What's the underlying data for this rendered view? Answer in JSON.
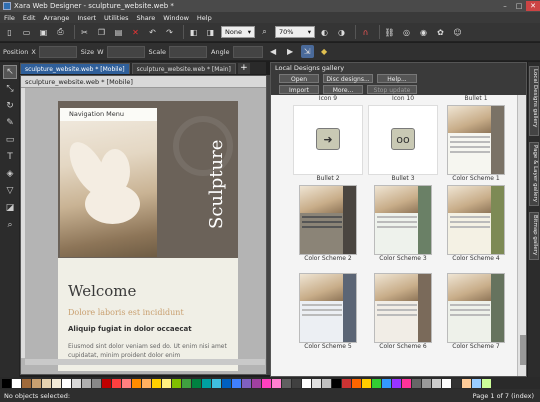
{
  "window": {
    "title": "Xara Web Designer - sculpture_website.web *",
    "minimize": "–",
    "maximize": "□",
    "close": "✕"
  },
  "menu": [
    "File",
    "Edit",
    "Arrange",
    "Insert",
    "Utilities",
    "Share",
    "Window",
    "Help"
  ],
  "toolbar": {
    "quality_select": "None",
    "zoom_select": "70%"
  },
  "infobar": {
    "position_label": "Position",
    "x_label": "X",
    "y_label": "Y",
    "size_label": "Size",
    "w_label": "W",
    "h_label": "H",
    "scale_label": "Scale",
    "angle_label": "Angle"
  },
  "doc_tabs": [
    {
      "label": "sculpture_website.web * [Mobile]",
      "active": true
    },
    {
      "label": "sculpture_website.web * [Main]",
      "active": false
    }
  ],
  "doc_tab_add": "+",
  "doc_window": {
    "title": "sculpture_website.web * [Mobile]",
    "nav_menu": "Navigation Menu",
    "sculpture": "Sculpture",
    "welcome": "Welcome",
    "subheading": "Dolore laboris est incididunt",
    "bold_line": "Aliquip fugiat in dolor occaecat",
    "body_text": "Eiusmod sint dolor veniam sed do. Ut enim nisi amet cupidatat, minim proident dolor enim"
  },
  "gallery": {
    "title": "Local Designs gallery",
    "buttons": [
      {
        "label": "Open",
        "enabled": true
      },
      {
        "label": "Disc designs...",
        "enabled": true
      },
      {
        "label": "Help...",
        "enabled": true
      },
      {
        "label": "Import",
        "enabled": true
      },
      {
        "label": "More...",
        "enabled": true
      },
      {
        "label": "Stop update",
        "enabled": false
      }
    ],
    "top_labels": [
      "Icon 9",
      "Icon 10",
      "Bullet 1"
    ],
    "rows": [
      [
        "Bullet 2",
        "Bullet 3",
        "Color Scheme 1"
      ],
      [
        "Color Scheme 2",
        "Color Scheme 3",
        "Color Scheme 4"
      ],
      [
        "Color Scheme 5",
        "Color Scheme 6",
        "Color Scheme 7"
      ]
    ],
    "bullet2_glyph": "➜",
    "bullet3_glyph": "oo"
  },
  "side_tabs": [
    "Local Designs gallery",
    "Page & Layer gallery",
    "Bitmap gallery"
  ],
  "status": {
    "selection": "No objects selected:",
    "page_indicator": "Page 1 of 7 (index)"
  },
  "palette_colors": [
    "#000000",
    "#ffffff",
    "#a06a3a",
    "#c8a070",
    "#e6d2b0",
    "#f3ead8",
    "#ffffff",
    "#d8d8d8",
    "#b0b0b0",
    "#888888",
    "#c00000",
    "#ff4040",
    "#ff8080",
    "#ff8c00",
    "#ffb060",
    "#ffd000",
    "#fff080",
    "#80c000",
    "#40a040",
    "#008040",
    "#00a0a0",
    "#40c0e0",
    "#0060c0",
    "#4080ff",
    "#8060c0",
    "#a040a0",
    "#ff40c0",
    "#ff80d0",
    "#606060",
    "#404040",
    "#ffffff",
    "#e0e0e0",
    "#c0c0c0",
    "#000000",
    "#cc3333",
    "#ff6600",
    "#ffcc00",
    "#33cc33",
    "#3399ff",
    "#9933ff",
    "#ff3399",
    "#666666",
    "#999999",
    "#cccccc",
    "#ffffff",
    "#333333",
    "#ffcc99",
    "#99ccff",
    "#ccff99"
  ]
}
